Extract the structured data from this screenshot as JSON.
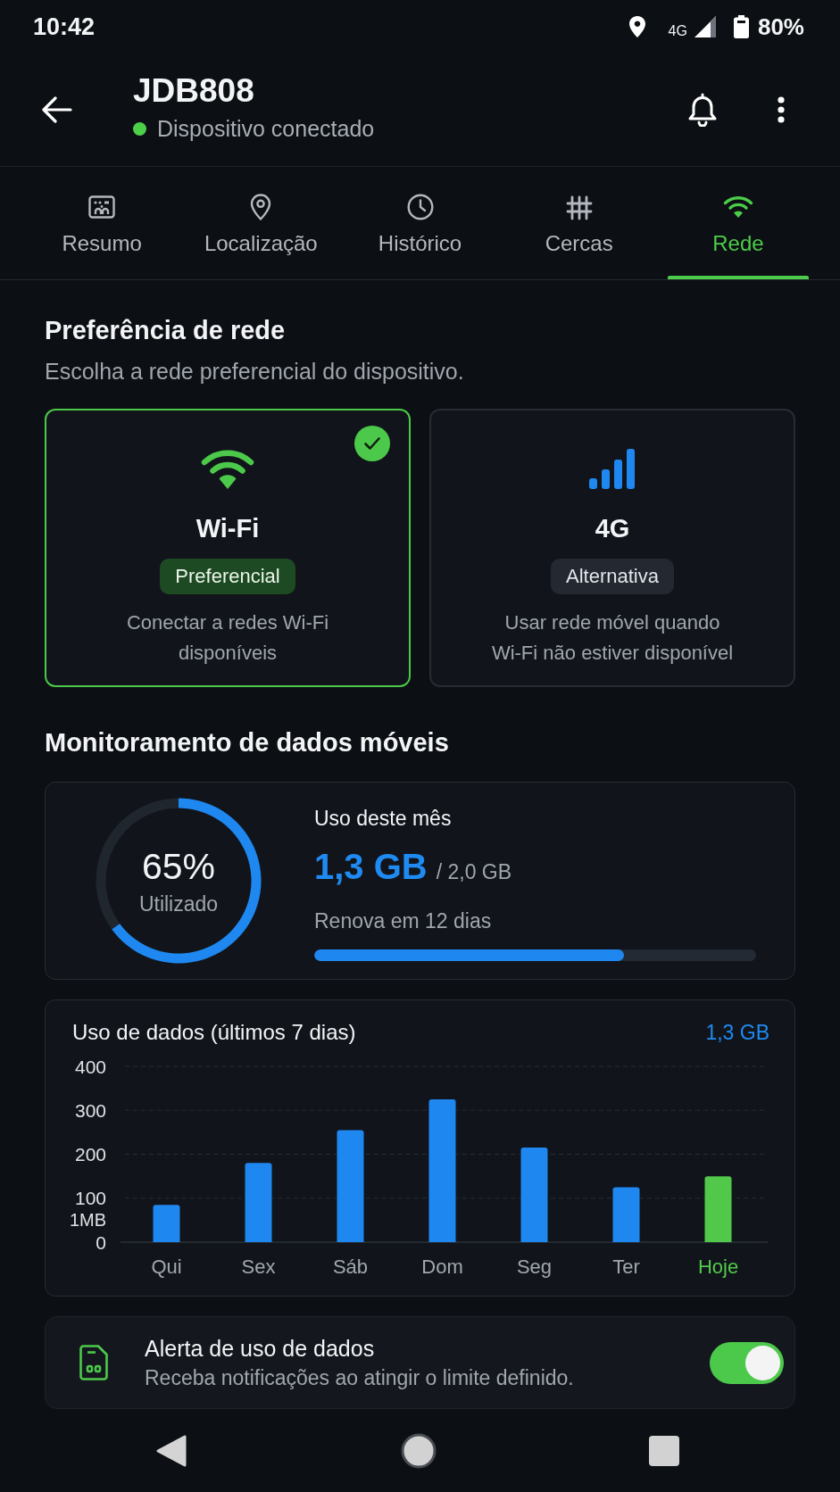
{
  "status_bar": {
    "time": "10:42",
    "network": "4G",
    "battery": "80%"
  },
  "header": {
    "title": "JDB808",
    "connected": true,
    "status": "Dispositivo conectado"
  },
  "tabs": [
    {
      "kind": "summary",
      "label": "Resumo",
      "selected": false
    },
    {
      "kind": "location",
      "label": "Localização",
      "selected": false
    },
    {
      "kind": "history",
      "label": "Histórico",
      "selected": false
    },
    {
      "kind": "fences",
      "label": "Cercas",
      "selected": false
    },
    {
      "kind": "network",
      "label": "Rede",
      "selected": true
    }
  ],
  "network_preference": {
    "title": "Preferência de rede",
    "subtitle": "Escolha a rede preferencial do dispositivo.",
    "options": [
      {
        "kind": "wifi",
        "name": "Wi-Fi",
        "badge": "Preferencial",
        "description_lines": [
          "Conectar a redes Wi-Fi",
          "disponíveis"
        ],
        "selected": true
      },
      {
        "kind": "cellular",
        "name": "4G",
        "badge": "Alternativa",
        "description_lines": [
          "Usar rede móvel quando",
          "Wi-Fi não estiver disponível"
        ],
        "selected": false
      }
    ]
  },
  "data_monitoring": {
    "title": "Monitoramento de dados móveis",
    "usage": {
      "ring": {
        "percent": "65%",
        "label": "Utilizado",
        "chart_data": {
          "type": "donut",
          "values": [
            65,
            35
          ]
        }
      },
      "title": "Uso deste mês",
      "used": "1,3 GB",
      "total": "/ 2,0 GB",
      "renewal": "Renova em 12 dias",
      "bar": {
        "level": 0.7
      }
    },
    "chart_card": {
      "total": "1,3 GB",
      "chart_data": {
        "type": "bar",
        "title": "Uso de dados (últimos 7 dias)",
        "ylabel": "1MB",
        "categories": [
          "Qui",
          "Sex",
          "Sáb",
          "Dom",
          "Seg",
          "Ter",
          "Hoje"
        ],
        "series": [
          {
            "color": "#1e88f0",
            "values": [
              85,
              180,
              255,
              325,
              215,
              125,
              null
            ]
          },
          {
            "color": "#52c84a",
            "values": [
              null,
              null,
              null,
              null,
              null,
              null,
              150
            ]
          }
        ],
        "ylim": [
          0,
          400
        ],
        "yticks": [
          0,
          100,
          200,
          300,
          400
        ],
        "grid": true,
        "stacked": true
      }
    },
    "alert": {
      "title": "Alerta de uso de dados",
      "description": "Receba notificações ao atingir o limite definido.",
      "on": true
    }
  }
}
